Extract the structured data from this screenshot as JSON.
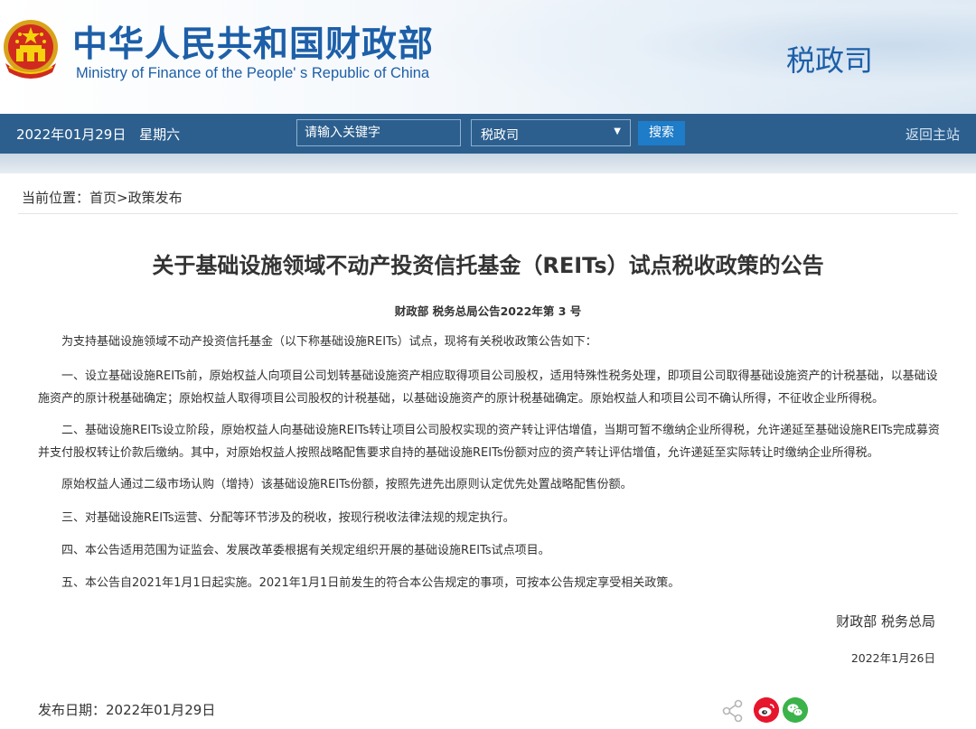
{
  "header": {
    "title_cn": "中华人民共和国财政部",
    "title_en": "Ministry of Finance of the People' s Republic of China",
    "department": "税政司"
  },
  "navbar": {
    "date": "2022年01月29日",
    "weekday": "星期六",
    "search_placeholder": "请输入关键字",
    "select_value": "税政司",
    "search_button": "搜索",
    "home_link": "返回主站"
  },
  "breadcrumb": {
    "text": "当前位置：首页>政策发布"
  },
  "article": {
    "title": "关于基础设施领域不动产投资信托基金（REITs）试点税收政策的公告",
    "doc_number": "财政部 税务总局公告2022年第 3 号",
    "paragraphs": [
      "为支持基础设施领域不动产投资信托基金（以下称基础设施REITs）试点，现将有关税收政策公告如下：",
      "一、设立基础设施REITs前，原始权益人向项目公司划转基础设施资产相应取得项目公司股权，适用特殊性税务处理，即项目公司取得基础设施资产的计税基础，以基础设施资产的原计税基础确定；原始权益人取得项目公司股权的计税基础，以基础设施资产的原计税基础确定。原始权益人和项目公司不确认所得，不征收企业所得税。",
      "二、基础设施REITs设立阶段，原始权益人向基础设施REITs转让项目公司股权实现的资产转让评估增值，当期可暂不缴纳企业所得税，允许递延至基础设施REITs完成募资并支付股权转让价款后缴纳。其中，对原始权益人按照战略配售要求自持的基础设施REITs份额对应的资产转让评估增值，允许递延至实际转让时缴纳企业所得税。",
      "原始权益人通过二级市场认购（增持）该基础设施REITs份额，按照先进先出原则认定优先处置战略配售份额。",
      "三、对基础设施REITs运营、分配等环节涉及的税收，按现行税收法律法规的规定执行。",
      "四、本公告适用范围为证监会、发展改革委根据有关规定组织开展的基础设施REITs试点项目。",
      "五、本公告自2021年1月1日起实施。2021年1月1日前发生的符合本公告规定的事项，可按本公告规定享受相关政策。"
    ],
    "signature": "财政部  税务总局",
    "sign_date": "2022年1月26日",
    "publish_date": "发布日期：2022年01月29日"
  },
  "icons": {
    "share": "share-icon",
    "weibo": "weibo-icon",
    "wechat": "wechat-icon"
  },
  "colors": {
    "brand_blue": "#1d5fa8",
    "navbar": "#2c5f8e",
    "search_button": "#1e7cc8",
    "weibo": "#e6162d",
    "wechat": "#3bb34a"
  }
}
